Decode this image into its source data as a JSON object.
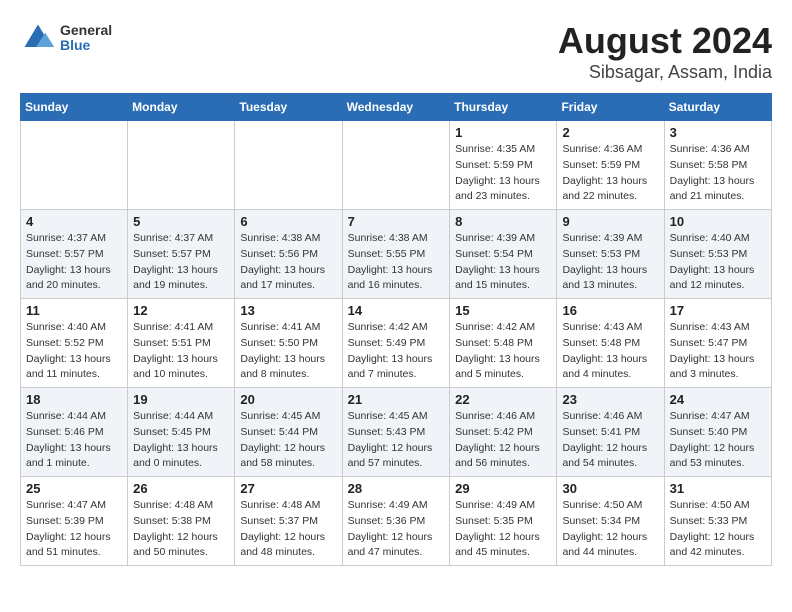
{
  "header": {
    "logo_general": "General",
    "logo_blue": "Blue",
    "month_year": "August 2024",
    "location": "Sibsagar, Assam, India"
  },
  "days_of_week": [
    "Sunday",
    "Monday",
    "Tuesday",
    "Wednesday",
    "Thursday",
    "Friday",
    "Saturday"
  ],
  "weeks": [
    [
      {
        "day": "",
        "info": ""
      },
      {
        "day": "",
        "info": ""
      },
      {
        "day": "",
        "info": ""
      },
      {
        "day": "",
        "info": ""
      },
      {
        "day": "1",
        "info": "Sunrise: 4:35 AM\nSunset: 5:59 PM\nDaylight: 13 hours\nand 23 minutes."
      },
      {
        "day": "2",
        "info": "Sunrise: 4:36 AM\nSunset: 5:59 PM\nDaylight: 13 hours\nand 22 minutes."
      },
      {
        "day": "3",
        "info": "Sunrise: 4:36 AM\nSunset: 5:58 PM\nDaylight: 13 hours\nand 21 minutes."
      }
    ],
    [
      {
        "day": "4",
        "info": "Sunrise: 4:37 AM\nSunset: 5:57 PM\nDaylight: 13 hours\nand 20 minutes."
      },
      {
        "day": "5",
        "info": "Sunrise: 4:37 AM\nSunset: 5:57 PM\nDaylight: 13 hours\nand 19 minutes."
      },
      {
        "day": "6",
        "info": "Sunrise: 4:38 AM\nSunset: 5:56 PM\nDaylight: 13 hours\nand 17 minutes."
      },
      {
        "day": "7",
        "info": "Sunrise: 4:38 AM\nSunset: 5:55 PM\nDaylight: 13 hours\nand 16 minutes."
      },
      {
        "day": "8",
        "info": "Sunrise: 4:39 AM\nSunset: 5:54 PM\nDaylight: 13 hours\nand 15 minutes."
      },
      {
        "day": "9",
        "info": "Sunrise: 4:39 AM\nSunset: 5:53 PM\nDaylight: 13 hours\nand 13 minutes."
      },
      {
        "day": "10",
        "info": "Sunrise: 4:40 AM\nSunset: 5:53 PM\nDaylight: 13 hours\nand 12 minutes."
      }
    ],
    [
      {
        "day": "11",
        "info": "Sunrise: 4:40 AM\nSunset: 5:52 PM\nDaylight: 13 hours\nand 11 minutes."
      },
      {
        "day": "12",
        "info": "Sunrise: 4:41 AM\nSunset: 5:51 PM\nDaylight: 13 hours\nand 10 minutes."
      },
      {
        "day": "13",
        "info": "Sunrise: 4:41 AM\nSunset: 5:50 PM\nDaylight: 13 hours\nand 8 minutes."
      },
      {
        "day": "14",
        "info": "Sunrise: 4:42 AM\nSunset: 5:49 PM\nDaylight: 13 hours\nand 7 minutes."
      },
      {
        "day": "15",
        "info": "Sunrise: 4:42 AM\nSunset: 5:48 PM\nDaylight: 13 hours\nand 5 minutes."
      },
      {
        "day": "16",
        "info": "Sunrise: 4:43 AM\nSunset: 5:48 PM\nDaylight: 13 hours\nand 4 minutes."
      },
      {
        "day": "17",
        "info": "Sunrise: 4:43 AM\nSunset: 5:47 PM\nDaylight: 13 hours\nand 3 minutes."
      }
    ],
    [
      {
        "day": "18",
        "info": "Sunrise: 4:44 AM\nSunset: 5:46 PM\nDaylight: 13 hours\nand 1 minute."
      },
      {
        "day": "19",
        "info": "Sunrise: 4:44 AM\nSunset: 5:45 PM\nDaylight: 13 hours\nand 0 minutes."
      },
      {
        "day": "20",
        "info": "Sunrise: 4:45 AM\nSunset: 5:44 PM\nDaylight: 12 hours\nand 58 minutes."
      },
      {
        "day": "21",
        "info": "Sunrise: 4:45 AM\nSunset: 5:43 PM\nDaylight: 12 hours\nand 57 minutes."
      },
      {
        "day": "22",
        "info": "Sunrise: 4:46 AM\nSunset: 5:42 PM\nDaylight: 12 hours\nand 56 minutes."
      },
      {
        "day": "23",
        "info": "Sunrise: 4:46 AM\nSunset: 5:41 PM\nDaylight: 12 hours\nand 54 minutes."
      },
      {
        "day": "24",
        "info": "Sunrise: 4:47 AM\nSunset: 5:40 PM\nDaylight: 12 hours\nand 53 minutes."
      }
    ],
    [
      {
        "day": "25",
        "info": "Sunrise: 4:47 AM\nSunset: 5:39 PM\nDaylight: 12 hours\nand 51 minutes."
      },
      {
        "day": "26",
        "info": "Sunrise: 4:48 AM\nSunset: 5:38 PM\nDaylight: 12 hours\nand 50 minutes."
      },
      {
        "day": "27",
        "info": "Sunrise: 4:48 AM\nSunset: 5:37 PM\nDaylight: 12 hours\nand 48 minutes."
      },
      {
        "day": "28",
        "info": "Sunrise: 4:49 AM\nSunset: 5:36 PM\nDaylight: 12 hours\nand 47 minutes."
      },
      {
        "day": "29",
        "info": "Sunrise: 4:49 AM\nSunset: 5:35 PM\nDaylight: 12 hours\nand 45 minutes."
      },
      {
        "day": "30",
        "info": "Sunrise: 4:50 AM\nSunset: 5:34 PM\nDaylight: 12 hours\nand 44 minutes."
      },
      {
        "day": "31",
        "info": "Sunrise: 4:50 AM\nSunset: 5:33 PM\nDaylight: 12 hours\nand 42 minutes."
      }
    ]
  ]
}
